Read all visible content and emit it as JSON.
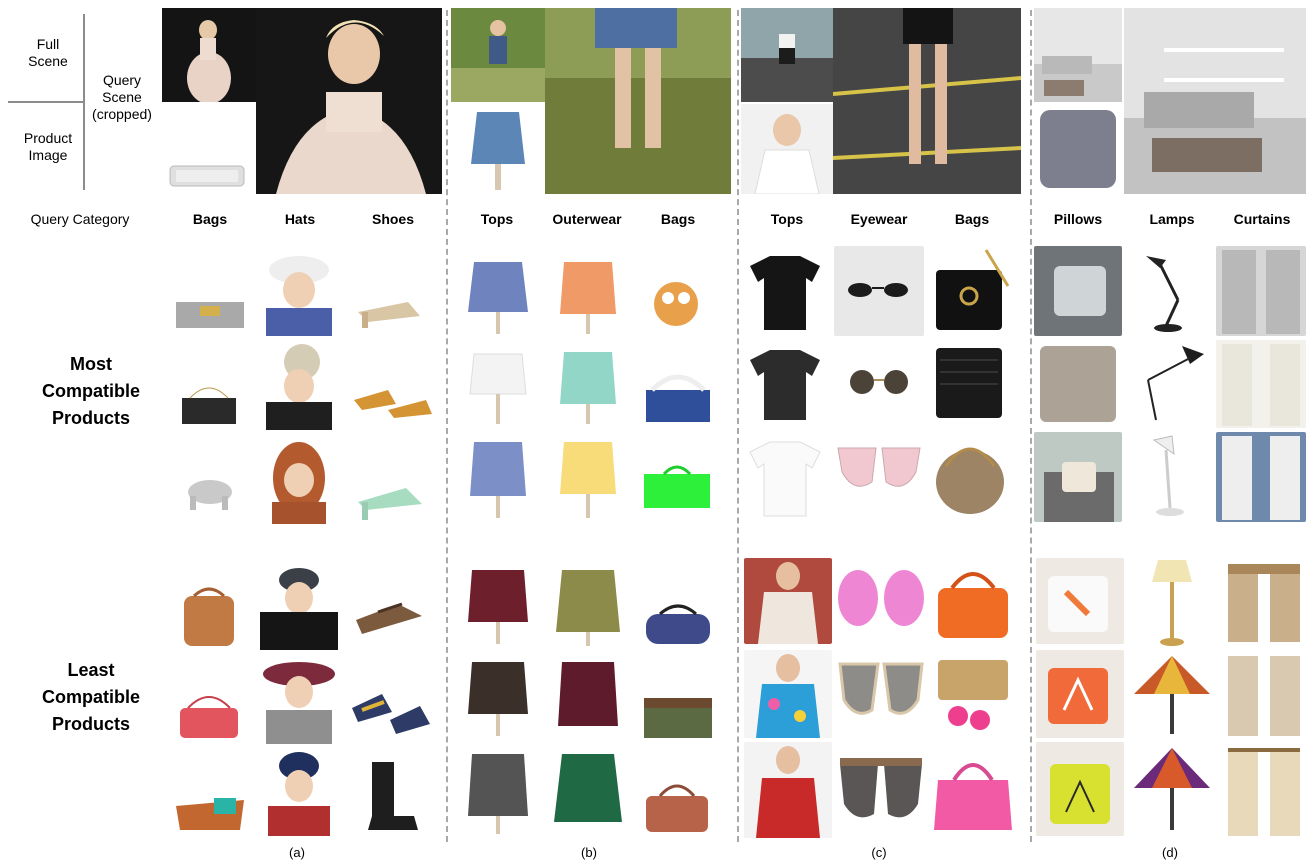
{
  "legend": {
    "full_scene": "Full\nScene",
    "product_image": "Product\nImage",
    "query_scene": "Query\nScene\n(cropped)"
  },
  "query_category_label": "Query Category",
  "row_labels": {
    "most": "Most\nCompatible\nProducts",
    "least": "Least\nCompatible\nProducts"
  },
  "panels": [
    {
      "label": "(a)",
      "categories": [
        "Bags",
        "Hats",
        "Shoes"
      ]
    },
    {
      "label": "(b)",
      "categories": [
        "Tops",
        "Outerwear",
        "Bags"
      ]
    },
    {
      "label": "(c)",
      "categories": [
        "Tops",
        "Eyewear",
        "Bags"
      ]
    },
    {
      "label": "(d)",
      "categories": [
        "Pillows",
        "Lamps",
        "Curtains"
      ]
    }
  ],
  "colors": {
    "separator": "#a9a9a9"
  }
}
